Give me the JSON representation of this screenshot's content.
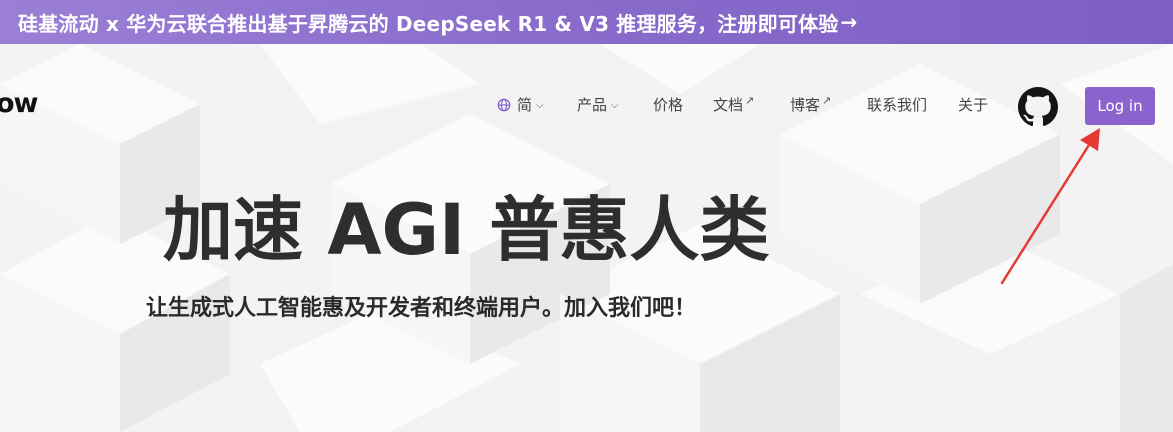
{
  "banner": {
    "text": "硅基流动 x 华为云联合推出基于昇腾云的 DeepSeek R1 & V3 推理服务，注册即可体验",
    "arrow": "→"
  },
  "logo": {
    "text": "ow"
  },
  "nav": {
    "language": "简",
    "products": "产品",
    "pricing": "价格",
    "docs": "文档",
    "blog": "博客",
    "contact": "联系我们",
    "about": "关于"
  },
  "login": {
    "label": "Log in"
  },
  "hero": {
    "title": "加速 AGI 普惠人类",
    "subtitle": "让生成式人工智能惠及开发者和终端用户。加入我们吧！"
  },
  "colors": {
    "accent": "#8a63cf",
    "banner": "#8a6ccc",
    "annotation_arrow": "#e53935"
  },
  "icons": [
    "globe-icon",
    "chevron-down-icon",
    "external-link-icon",
    "github-icon"
  ]
}
